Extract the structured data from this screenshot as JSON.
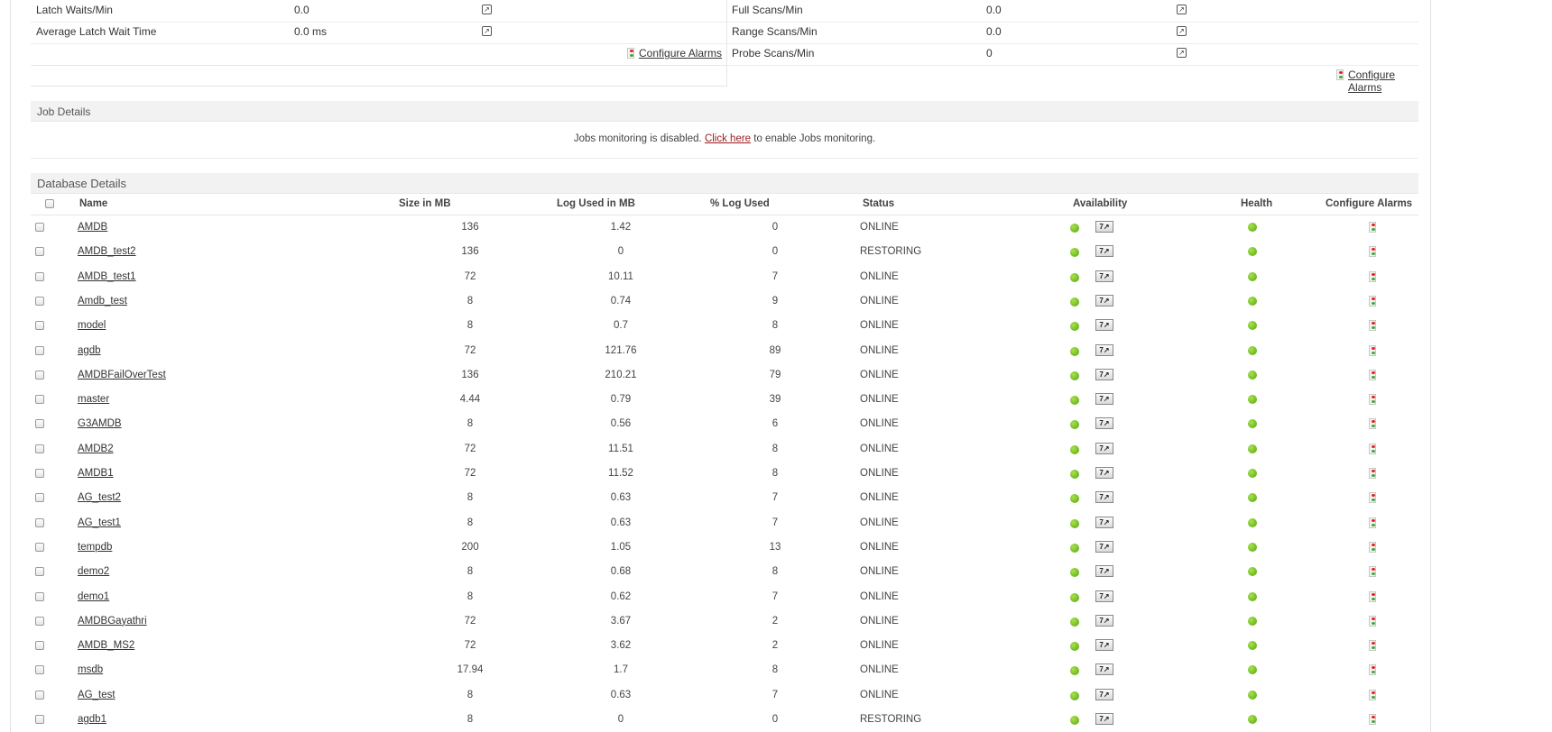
{
  "left_metrics": [
    {
      "label": "Latch Waits/Min",
      "value": "0.0"
    },
    {
      "label": "Average Latch Wait Time",
      "value": "0.0 ms"
    }
  ],
  "right_metrics": [
    {
      "label": "Full Scans/Min",
      "value": "0.0"
    },
    {
      "label": "Range Scans/Min",
      "value": "0.0"
    },
    {
      "label": "Probe Scans/Min",
      "value": "0"
    }
  ],
  "configure_alarms_label": "Configure Alarms",
  "job_details": {
    "title": "Job Details",
    "message_before": "Jobs monitoring is disabled. ",
    "link_text": "Click here",
    "message_after": " to enable Jobs monitoring."
  },
  "database_details": {
    "title": "Database Details",
    "columns": {
      "name": "Name",
      "size": "Size in MB",
      "log_used": "Log Used in MB",
      "pct_log_used": "% Log Used",
      "status": "Status",
      "availability": "Availability",
      "health": "Health",
      "configure_alarms": "Configure Alarms"
    },
    "rows": [
      {
        "name": "AMDB",
        "size": "136",
        "log_used": "1.42",
        "pct": "0",
        "status": "ONLINE"
      },
      {
        "name": "AMDB_test2",
        "size": "136",
        "log_used": "0",
        "pct": "0",
        "status": "RESTORING"
      },
      {
        "name": "AMDB_test1",
        "size": "72",
        "log_used": "10.11",
        "pct": "7",
        "status": "ONLINE"
      },
      {
        "name": "Amdb_test",
        "size": "8",
        "log_used": "0.74",
        "pct": "9",
        "status": "ONLINE"
      },
      {
        "name": "model",
        "size": "8",
        "log_used": "0.7",
        "pct": "8",
        "status": "ONLINE"
      },
      {
        "name": "agdb",
        "size": "72",
        "log_used": "121.76",
        "pct": "89",
        "status": "ONLINE"
      },
      {
        "name": "AMDBFailOverTest",
        "size": "136",
        "log_used": "210.21",
        "pct": "79",
        "status": "ONLINE"
      },
      {
        "name": "master",
        "size": "4.44",
        "log_used": "0.79",
        "pct": "39",
        "status": "ONLINE"
      },
      {
        "name": "G3AMDB",
        "size": "8",
        "log_used": "0.56",
        "pct": "6",
        "status": "ONLINE"
      },
      {
        "name": "AMDB2",
        "size": "72",
        "log_used": "11.51",
        "pct": "8",
        "status": "ONLINE"
      },
      {
        "name": "AMDB1",
        "size": "72",
        "log_used": "11.52",
        "pct": "8",
        "status": "ONLINE"
      },
      {
        "name": "AG_test2",
        "size": "8",
        "log_used": "0.63",
        "pct": "7",
        "status": "ONLINE"
      },
      {
        "name": "AG_test1",
        "size": "8",
        "log_used": "0.63",
        "pct": "7",
        "status": "ONLINE"
      },
      {
        "name": "tempdb",
        "size": "200",
        "log_used": "1.05",
        "pct": "13",
        "status": "ONLINE"
      },
      {
        "name": "demo2",
        "size": "8",
        "log_used": "0.68",
        "pct": "8",
        "status": "ONLINE"
      },
      {
        "name": "demo1",
        "size": "8",
        "log_used": "0.62",
        "pct": "7",
        "status": "ONLINE"
      },
      {
        "name": "AMDBGayathri",
        "size": "72",
        "log_used": "3.67",
        "pct": "2",
        "status": "ONLINE"
      },
      {
        "name": "AMDB_MS2",
        "size": "72",
        "log_used": "3.62",
        "pct": "2",
        "status": "ONLINE"
      },
      {
        "name": "msdb",
        "size": "17.94",
        "log_used": "1.7",
        "pct": "8",
        "status": "ONLINE"
      },
      {
        "name": "AG_test",
        "size": "8",
        "log_used": "0.63",
        "pct": "7",
        "status": "ONLINE"
      },
      {
        "name": "agdb1",
        "size": "8",
        "log_used": "0",
        "pct": "0",
        "status": "RESTORING"
      }
    ]
  },
  "icons": {
    "graph": "popup-graph-icon",
    "alarm": "traffic-light-icon",
    "availability": "green-status-icon",
    "report": "availability-report-icon"
  },
  "colors": {
    "status_green": "#58a40f",
    "link_red": "#9b1a1a",
    "section_bg": "#f2f2f2"
  }
}
